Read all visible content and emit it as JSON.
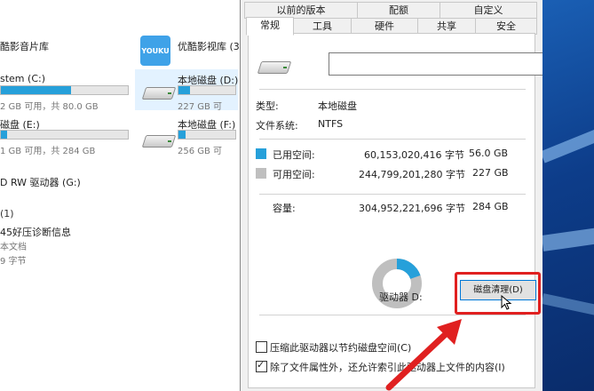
{
  "explorer": {
    "top_left_item": "酷影音片库",
    "youku_tile_text": "YOUKU",
    "youku_library": "优酷影视库 (3:",
    "drive_c": {
      "name": "stem (C:)",
      "usage": "2 GB 可用，共 80.0 GB",
      "used_fraction": 0.55
    },
    "drive_d": {
      "name": "本地磁盘 (D:)",
      "usage": "227 GB 可",
      "used_fraction": 0.2
    },
    "drive_e": {
      "name": "磁盘 (E:)",
      "usage": "1 GB 可用，共 284 GB",
      "used_fraction": 0.05
    },
    "drive_f": {
      "name": "本地磁盘 (F:)",
      "usage": "256 GB 可",
      "used_fraction": 0.12
    },
    "dvd": "D RW 驱动器 (G:)",
    "section": "(1)",
    "file_title": "45好压诊断信息",
    "file_type": "本文档",
    "file_size": "9 字节"
  },
  "dialog": {
    "tabs_top": [
      "以前的版本",
      "配额",
      "自定义"
    ],
    "tabs_bottom": [
      "常规",
      "工具",
      "硬件",
      "共享",
      "安全"
    ],
    "active_tab": "常规",
    "type_label": "类型:",
    "type_value": "本地磁盘",
    "fs_label": "文件系统:",
    "fs_value": "NTFS",
    "used_label": "已用空间:",
    "used_bytes": "60,153,020,416 字节",
    "used_gb": "56.0 GB",
    "free_label": "可用空间:",
    "free_bytes": "244,799,201,280 字节",
    "free_gb": "227 GB",
    "cap_label": "容量:",
    "cap_bytes": "304,952,221,696 字节",
    "cap_gb": "284 GB",
    "drive_label": "驱动器 D:",
    "cleanup_button": "磁盘清理(D)",
    "compress_label": "压缩此驱动器以节约磁盘空间(C)",
    "index_label": "除了文件属性外，还允许索引此驱动器上文件的内容(I)",
    "used_fraction": 0.197,
    "colors": {
      "used": "#26a0da",
      "free": "#bfbfbf",
      "highlight": "#e02020"
    }
  }
}
